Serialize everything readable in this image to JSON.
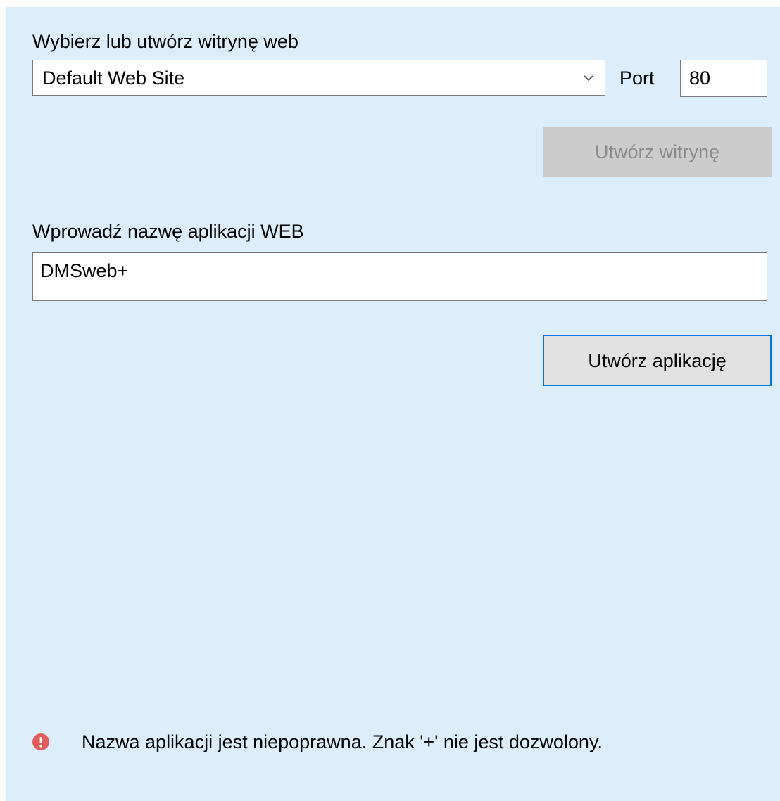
{
  "site": {
    "label": "Wybierz lub utwórz witrynę web",
    "selected": "Default Web Site",
    "port_label": "Port",
    "port_value": "80",
    "create_button": "Utwórz witrynę"
  },
  "app": {
    "label": "Wprowadź nazwę aplikacji WEB",
    "name_value": "DMSweb+",
    "create_button": "Utwórz aplikację"
  },
  "error": {
    "icon": "error-icon",
    "message": "Nazwa aplikacji jest niepoprawna. Znak '+' nie jest dozwolony."
  },
  "colors": {
    "background": "#dcedfc",
    "error": "#e85a5a",
    "focus_border": "#0078d7",
    "disabled_button": "#cccccc"
  }
}
